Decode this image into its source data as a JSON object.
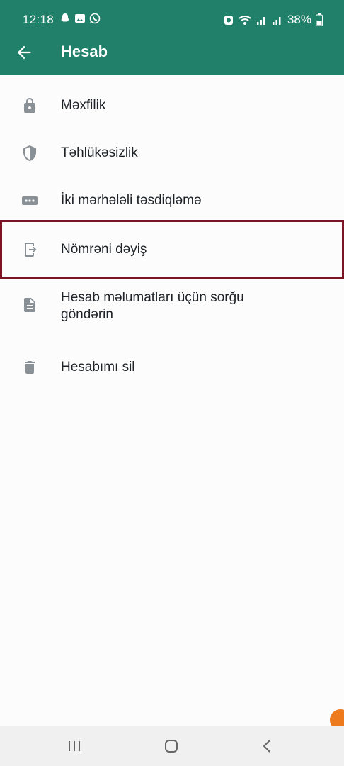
{
  "status": {
    "time": "12:18",
    "battery": "38%"
  },
  "header": {
    "title": "Hesab"
  },
  "items": [
    {
      "label": "Məxfilik"
    },
    {
      "label": "Təhlükəsizlik"
    },
    {
      "label": "İki mərhələli təsdiqləmə"
    },
    {
      "label": "Nömrəni dəyiş"
    },
    {
      "label": "Hesab məlumatları üçün sorğu göndərin"
    },
    {
      "label": "Hesabımı sil"
    }
  ],
  "colors": {
    "accent": "#208069",
    "highlight": "#7a1322",
    "icon": "#8a9196"
  }
}
